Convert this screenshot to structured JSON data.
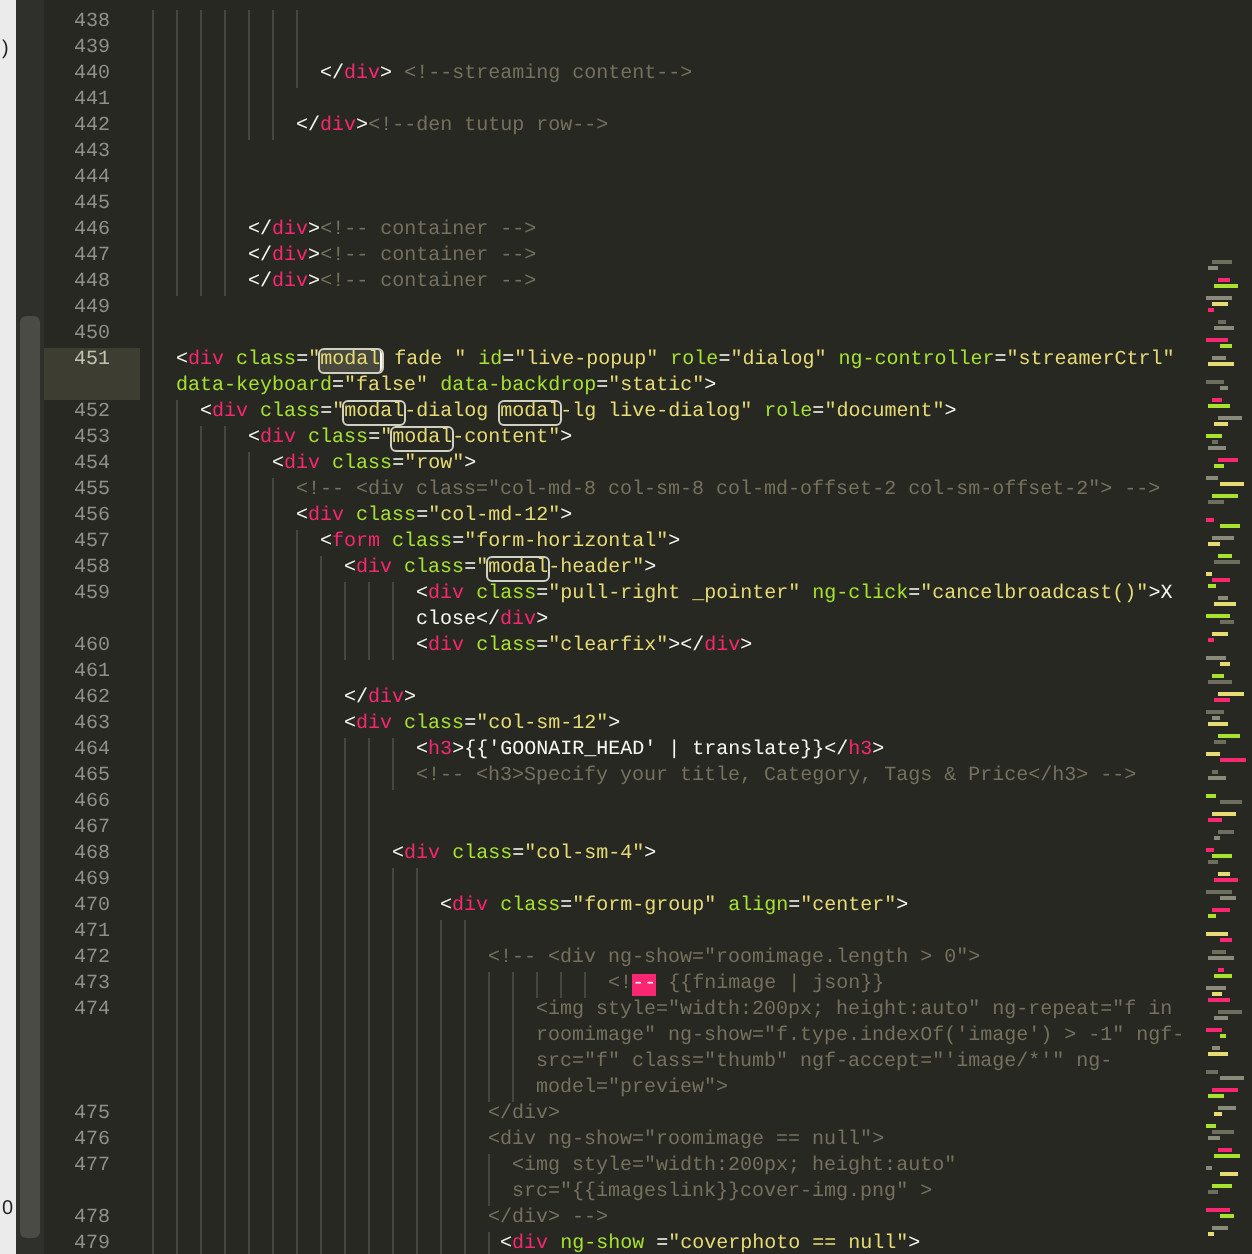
{
  "background_window": {
    "fragments": [
      ")",
      "0"
    ]
  },
  "editor": {
    "lines": [
      {
        "number": "438",
        "current": false
      },
      {
        "number": "439",
        "current": false
      },
      {
        "number": "440",
        "current": false,
        "rows": [
          {
            "segments": [
              {
                "kind": "punct",
                "text": "              </"
              },
              {
                "kind": "tag",
                "text": "div"
              },
              {
                "kind": "punct",
                "text": ">"
              },
              {
                "kind": "comment",
                "text": " <!--streaming content-->"
              }
            ]
          }
        ]
      },
      {
        "number": "441",
        "current": false
      },
      {
        "number": "442",
        "current": false,
        "rows": [
          {
            "segments": [
              {
                "kind": "punct",
                "text": "            </"
              },
              {
                "kind": "tag",
                "text": "div"
              },
              {
                "kind": "punct",
                "text": ">"
              },
              {
                "kind": "comment",
                "text": "<!--den tutup row-->"
              }
            ]
          }
        ]
      },
      {
        "number": "443",
        "current": false
      },
      {
        "number": "444",
        "current": false
      },
      {
        "number": "445",
        "current": false
      },
      {
        "number": "446",
        "current": false,
        "rows": [
          {
            "segments": [
              {
                "kind": "punct",
                "text": "        </"
              },
              {
                "kind": "tag",
                "text": "div"
              },
              {
                "kind": "punct",
                "text": ">"
              },
              {
                "kind": "comment",
                "text": "<!-- container -->"
              }
            ]
          }
        ]
      },
      {
        "number": "447",
        "current": false,
        "rows": [
          {
            "segments": [
              {
                "kind": "punct",
                "text": "        </"
              },
              {
                "kind": "tag",
                "text": "div"
              },
              {
                "kind": "punct",
                "text": ">"
              },
              {
                "kind": "comment",
                "text": "<!-- container -->"
              }
            ]
          }
        ]
      },
      {
        "number": "448",
        "current": false,
        "rows": [
          {
            "segments": [
              {
                "kind": "punct",
                "text": "        </"
              },
              {
                "kind": "tag",
                "text": "div"
              },
              {
                "kind": "punct",
                "text": ">"
              },
              {
                "kind": "comment",
                "text": "<!-- container -->"
              }
            ]
          }
        ]
      },
      {
        "number": "449",
        "current": false
      },
      {
        "number": "450",
        "current": false
      },
      {
        "number": "451",
        "current": true,
        "rows": [
          {
            "segments": [
              {
                "kind": "punct",
                "text": "  <"
              },
              {
                "kind": "tag",
                "text": "div"
              },
              {
                "kind": "attr",
                "text": " class"
              },
              {
                "kind": "punct",
                "text": "="
              },
              {
                "kind": "string",
                "text": "\""
              },
              {
                "kind": "match-active",
                "text": "modal",
                "cursor": true
              },
              {
                "kind": "string",
                "text": " fade \""
              },
              {
                "kind": "attr",
                "text": " id"
              },
              {
                "kind": "punct",
                "text": "="
              },
              {
                "kind": "string",
                "text": "\"live-popup\""
              },
              {
                "kind": "attr",
                "text": " role"
              },
              {
                "kind": "punct",
                "text": "="
              },
              {
                "kind": "string",
                "text": "\"dialog\""
              },
              {
                "kind": "attr",
                "text": " ng-controller"
              },
              {
                "kind": "punct",
                "text": "="
              },
              {
                "kind": "string",
                "text": "\"streamerCtrl\""
              }
            ]
          },
          {
            "segments": [
              {
                "kind": "attr",
                "text": "  data-keyboard"
              },
              {
                "kind": "punct",
                "text": "="
              },
              {
                "kind": "string",
                "text": "\"false\""
              },
              {
                "kind": "attr",
                "text": " data-backdrop"
              },
              {
                "kind": "punct",
                "text": "="
              },
              {
                "kind": "string",
                "text": "\"static\""
              },
              {
                "kind": "punct",
                "text": ">"
              }
            ]
          }
        ]
      },
      {
        "number": "452",
        "current": false,
        "rows": [
          {
            "segments": [
              {
                "kind": "punct",
                "text": "    <"
              },
              {
                "kind": "tag",
                "text": "div"
              },
              {
                "kind": "attr",
                "text": " class"
              },
              {
                "kind": "punct",
                "text": "="
              },
              {
                "kind": "string",
                "text": "\""
              },
              {
                "kind": "match",
                "text": "modal"
              },
              {
                "kind": "string",
                "text": "-dialog "
              },
              {
                "kind": "match",
                "text": "modal"
              },
              {
                "kind": "string",
                "text": "-lg live-dialog\""
              },
              {
                "kind": "attr",
                "text": " role"
              },
              {
                "kind": "punct",
                "text": "="
              },
              {
                "kind": "string",
                "text": "\"document\""
              },
              {
                "kind": "punct",
                "text": ">"
              }
            ]
          }
        ]
      },
      {
        "number": "453",
        "current": false,
        "rows": [
          {
            "segments": [
              {
                "kind": "punct",
                "text": "        <"
              },
              {
                "kind": "tag",
                "text": "div"
              },
              {
                "kind": "attr",
                "text": " class"
              },
              {
                "kind": "punct",
                "text": "="
              },
              {
                "kind": "string",
                "text": "\""
              },
              {
                "kind": "match",
                "text": "modal"
              },
              {
                "kind": "string",
                "text": "-content\""
              },
              {
                "kind": "punct",
                "text": ">"
              }
            ]
          }
        ]
      },
      {
        "number": "454",
        "current": false,
        "rows": [
          {
            "segments": [
              {
                "kind": "punct",
                "text": "          <"
              },
              {
                "kind": "tag",
                "text": "div"
              },
              {
                "kind": "attr",
                "text": " class"
              },
              {
                "kind": "punct",
                "text": "="
              },
              {
                "kind": "string",
                "text": "\"row\""
              },
              {
                "kind": "punct",
                "text": ">"
              }
            ]
          }
        ]
      },
      {
        "number": "455",
        "current": false,
        "rows": [
          {
            "segments": [
              {
                "kind": "comment",
                "text": "            <!-- <div class=\"col-md-8 col-sm-8 col-md-offset-2 col-sm-offset-2\"> -->"
              }
            ]
          }
        ]
      },
      {
        "number": "456",
        "current": false,
        "rows": [
          {
            "segments": [
              {
                "kind": "punct",
                "text": "            <"
              },
              {
                "kind": "tag",
                "text": "div"
              },
              {
                "kind": "attr",
                "text": " class"
              },
              {
                "kind": "punct",
                "text": "="
              },
              {
                "kind": "string",
                "text": "\"col-md-12\""
              },
              {
                "kind": "punct",
                "text": ">"
              }
            ]
          }
        ]
      },
      {
        "number": "457",
        "current": false,
        "rows": [
          {
            "segments": [
              {
                "kind": "punct",
                "text": "              <"
              },
              {
                "kind": "tag",
                "text": "form"
              },
              {
                "kind": "attr",
                "text": " class"
              },
              {
                "kind": "punct",
                "text": "="
              },
              {
                "kind": "string",
                "text": "\"form-horizontal\""
              },
              {
                "kind": "punct",
                "text": ">"
              }
            ]
          }
        ]
      },
      {
        "number": "458",
        "current": false,
        "rows": [
          {
            "segments": [
              {
                "kind": "punct",
                "text": "                <"
              },
              {
                "kind": "tag",
                "text": "div"
              },
              {
                "kind": "attr",
                "text": " class"
              },
              {
                "kind": "punct",
                "text": "="
              },
              {
                "kind": "string",
                "text": "\""
              },
              {
                "kind": "match",
                "text": "modal"
              },
              {
                "kind": "string",
                "text": "-header\""
              },
              {
                "kind": "punct",
                "text": ">"
              }
            ]
          }
        ]
      },
      {
        "number": "459",
        "current": false,
        "rows": [
          {
            "segments": [
              {
                "kind": "punct",
                "text": "                      <"
              },
              {
                "kind": "tag",
                "text": "div"
              },
              {
                "kind": "attr",
                "text": " class"
              },
              {
                "kind": "punct",
                "text": "="
              },
              {
                "kind": "string",
                "text": "\"pull-right _pointer\""
              },
              {
                "kind": "attr",
                "text": " ng-click"
              },
              {
                "kind": "punct",
                "text": "="
              },
              {
                "kind": "string",
                "text": "\"cancelbroadcast()\""
              },
              {
                "kind": "punct",
                "text": ">X"
              }
            ]
          },
          {
            "segments": [
              {
                "kind": "punct",
                "text": "                      close</"
              },
              {
                "kind": "tag",
                "text": "div"
              },
              {
                "kind": "punct",
                "text": ">"
              }
            ]
          }
        ]
      },
      {
        "number": "460",
        "current": false,
        "rows": [
          {
            "segments": [
              {
                "kind": "punct",
                "text": "                      <"
              },
              {
                "kind": "tag",
                "text": "div"
              },
              {
                "kind": "attr",
                "text": " class"
              },
              {
                "kind": "punct",
                "text": "="
              },
              {
                "kind": "string",
                "text": "\"clearfix\""
              },
              {
                "kind": "punct",
                "text": "></"
              },
              {
                "kind": "tag",
                "text": "div"
              },
              {
                "kind": "punct",
                "text": ">"
              }
            ]
          }
        ]
      },
      {
        "number": "461",
        "current": false
      },
      {
        "number": "462",
        "current": false,
        "rows": [
          {
            "segments": [
              {
                "kind": "punct",
                "text": "                </"
              },
              {
                "kind": "tag",
                "text": "div"
              },
              {
                "kind": "punct",
                "text": ">"
              }
            ]
          }
        ]
      },
      {
        "number": "463",
        "current": false,
        "rows": [
          {
            "segments": [
              {
                "kind": "punct",
                "text": "                <"
              },
              {
                "kind": "tag",
                "text": "div"
              },
              {
                "kind": "attr",
                "text": " class"
              },
              {
                "kind": "punct",
                "text": "="
              },
              {
                "kind": "string",
                "text": "\"col-sm-12\""
              },
              {
                "kind": "punct",
                "text": ">"
              }
            ]
          }
        ]
      },
      {
        "number": "464",
        "current": false,
        "rows": [
          {
            "segments": [
              {
                "kind": "punct",
                "text": "                      <"
              },
              {
                "kind": "tag",
                "text": "h3"
              },
              {
                "kind": "punct",
                "text": ">{{'GOONAIR_HEAD' | translate}}</"
              },
              {
                "kind": "tag",
                "text": "h3"
              },
              {
                "kind": "punct",
                "text": ">"
              }
            ]
          }
        ]
      },
      {
        "number": "465",
        "current": false,
        "rows": [
          {
            "segments": [
              {
                "kind": "comment",
                "text": "                      <!-- <h3>Specify your title, Category, Tags & Price</h3> -->"
              }
            ]
          }
        ]
      },
      {
        "number": "466",
        "current": false
      },
      {
        "number": "467",
        "current": false
      },
      {
        "number": "468",
        "current": false,
        "rows": [
          {
            "segments": [
              {
                "kind": "punct",
                "text": "                    <"
              },
              {
                "kind": "tag",
                "text": "div"
              },
              {
                "kind": "attr",
                "text": " class"
              },
              {
                "kind": "punct",
                "text": "="
              },
              {
                "kind": "string",
                "text": "\"col-sm-4\""
              },
              {
                "kind": "punct",
                "text": ">"
              }
            ]
          }
        ]
      },
      {
        "number": "469",
        "current": false
      },
      {
        "number": "470",
        "current": false,
        "rows": [
          {
            "segments": [
              {
                "kind": "punct",
                "text": "                        <"
              },
              {
                "kind": "tag",
                "text": "div"
              },
              {
                "kind": "attr",
                "text": " class"
              },
              {
                "kind": "punct",
                "text": "="
              },
              {
                "kind": "string",
                "text": "\"form-group\""
              },
              {
                "kind": "attr",
                "text": " align"
              },
              {
                "kind": "punct",
                "text": "="
              },
              {
                "kind": "string",
                "text": "\"center\""
              },
              {
                "kind": "punct",
                "text": ">"
              }
            ]
          }
        ]
      },
      {
        "number": "471",
        "current": false
      },
      {
        "number": "472",
        "current": false,
        "rows": [
          {
            "segments": [
              {
                "kind": "comment",
                "text": "                            <!-- <div ng-show=\"roomimage.length > 0\">"
              }
            ]
          }
        ]
      },
      {
        "number": "473",
        "current": false,
        "rows": [
          {
            "segments": [
              {
                "kind": "comment",
                "text": "                                      <!"
              },
              {
                "kind": "error",
                "text": "--"
              },
              {
                "kind": "comment",
                "text": " {{fnimage | json}}"
              }
            ]
          }
        ]
      },
      {
        "number": "474",
        "current": false,
        "rows": [
          {
            "segments": [
              {
                "kind": "comment",
                "text": "                                <img style=\"width:200px; height:auto\" ng-repeat=\"f in"
              }
            ]
          },
          {
            "segments": [
              {
                "kind": "comment",
                "text": "                                roomimage\" ng-show=\"f.type.indexOf('image') > -1\" ngf-"
              }
            ]
          },
          {
            "segments": [
              {
                "kind": "comment",
                "text": "                                src=\"f\" class=\"thumb\" ngf-accept=\"'image/*'\" ng-"
              }
            ]
          },
          {
            "segments": [
              {
                "kind": "comment",
                "text": "                                model=\"preview\">"
              }
            ]
          }
        ]
      },
      {
        "number": "475",
        "current": false,
        "rows": [
          {
            "segments": [
              {
                "kind": "comment",
                "text": "                            </div>"
              }
            ]
          }
        ]
      },
      {
        "number": "476",
        "current": false,
        "rows": [
          {
            "segments": [
              {
                "kind": "comment",
                "text": "                            <div ng-show=\"roomimage == null\">"
              }
            ]
          }
        ]
      },
      {
        "number": "477",
        "current": false,
        "rows": [
          {
            "segments": [
              {
                "kind": "comment",
                "text": "                              <img style=\"width:200px; height:auto\""
              }
            ]
          },
          {
            "segments": [
              {
                "kind": "comment",
                "text": "                              src=\"{{imageslink}}cover-img.png\" >"
              }
            ]
          }
        ]
      },
      {
        "number": "478",
        "current": false,
        "rows": [
          {
            "segments": [
              {
                "kind": "comment",
                "text": "                            </div> -->"
              }
            ]
          }
        ]
      },
      {
        "number": "479",
        "current": false,
        "rows": [
          {
            "segments": [
              {
                "kind": "punct",
                "text": "                             <"
              },
              {
                "kind": "tag",
                "text": "div"
              },
              {
                "kind": "attr",
                "text": " ng-show "
              },
              {
                "kind": "punct",
                "text": "="
              },
              {
                "kind": "string",
                "text": "\"coverphoto == null\""
              },
              {
                "kind": "punct",
                "text": ">"
              }
            ]
          }
        ]
      }
    ]
  }
}
